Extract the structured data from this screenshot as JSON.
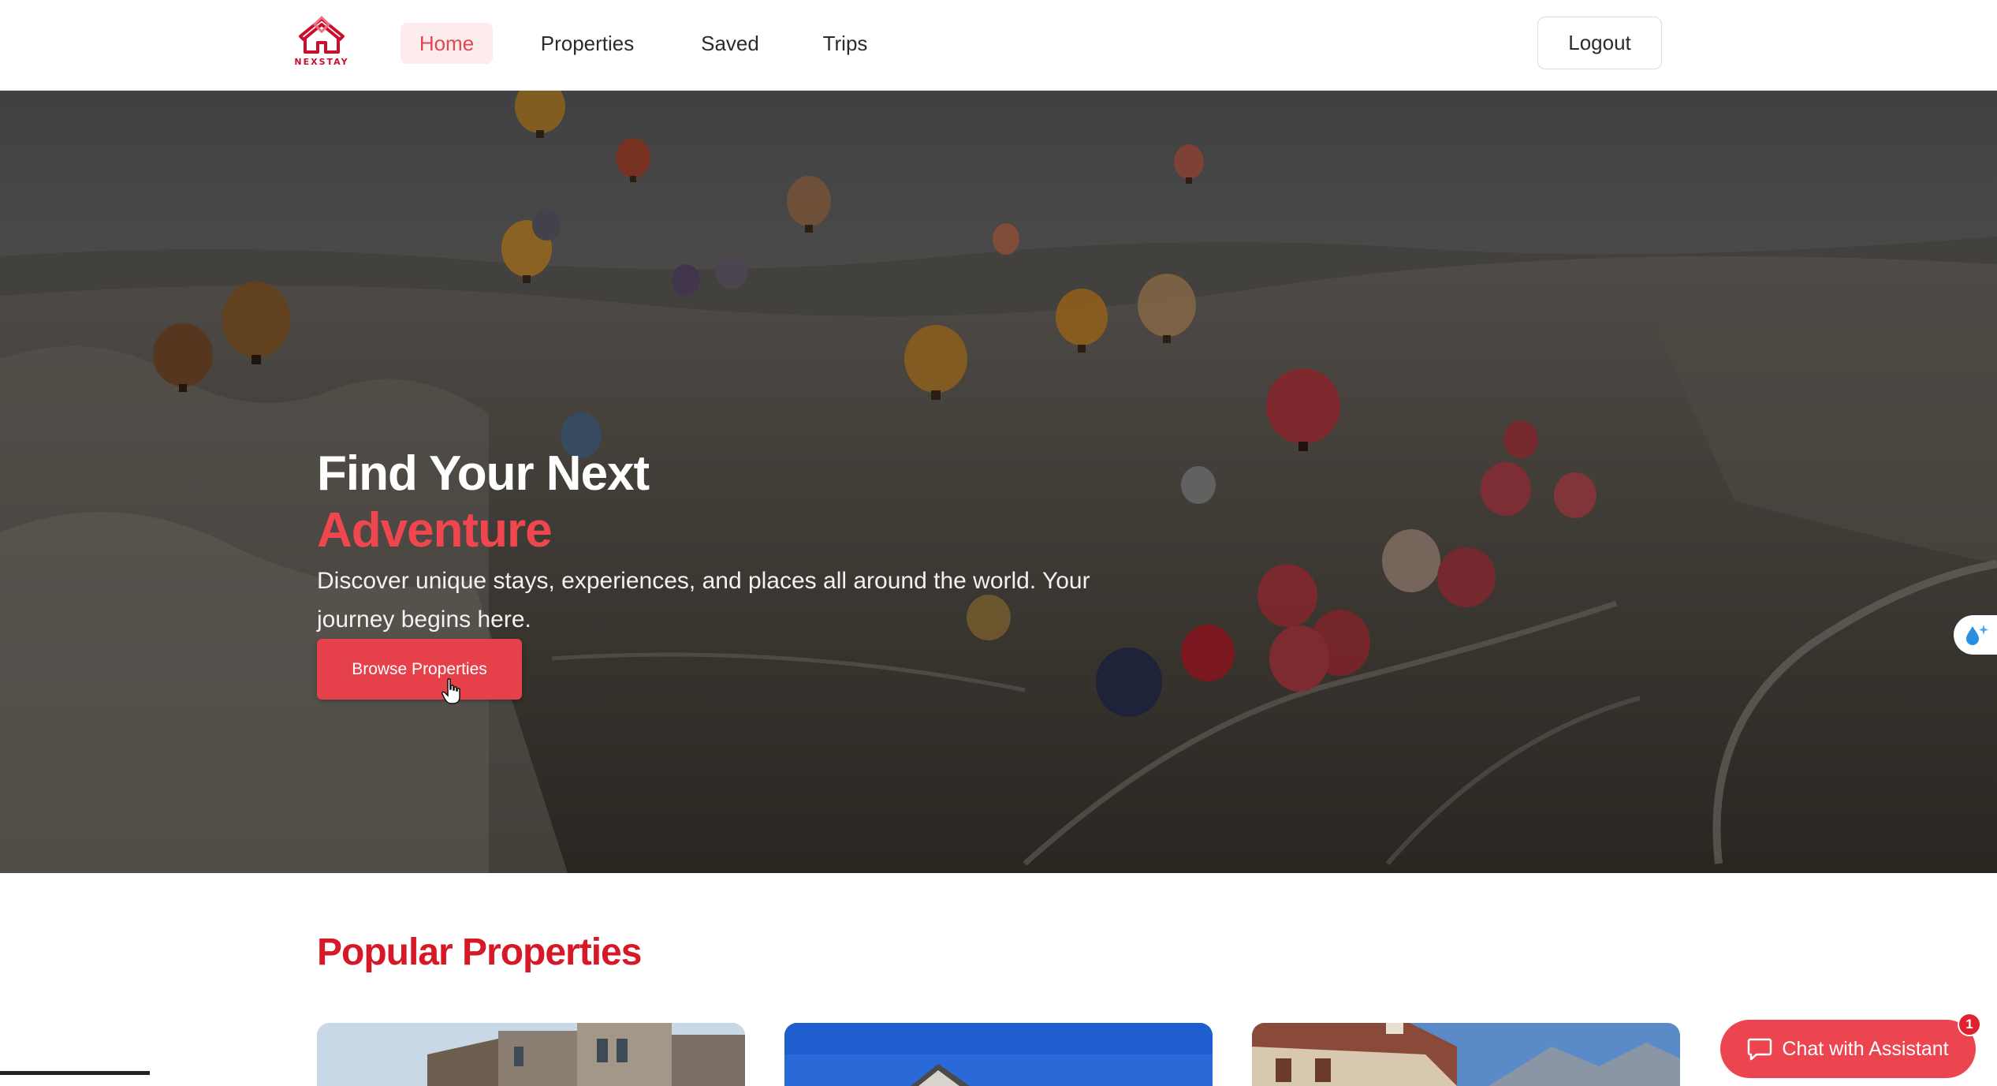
{
  "brand": {
    "name": "NEXSTAY",
    "color": "#c8102e"
  },
  "nav": {
    "items": [
      {
        "label": "Home",
        "active": true
      },
      {
        "label": "Properties",
        "active": false
      },
      {
        "label": "Saved",
        "active": false
      },
      {
        "label": "Trips",
        "active": false
      }
    ],
    "logout_label": "Logout"
  },
  "hero": {
    "title_line1": "Find Your Next",
    "title_line2": "Adventure",
    "subtitle": "Discover unique stays, experiences, and places all around the world. Your journey begins here.",
    "cta_label": "Browse Properties",
    "accent_color": "#f0474f"
  },
  "popular": {
    "title": "Popular Properties",
    "cards": [
      {
        "image": "apartment-building-photo"
      },
      {
        "image": "house-blue-sky-photo"
      },
      {
        "image": "resort-mountain-photo"
      }
    ]
  },
  "chat": {
    "label": "Chat with Assistant",
    "badge": "1",
    "color": "#ec4550"
  },
  "icons": {
    "logo": "house-logo-icon",
    "cursor": "hand-pointer-icon",
    "side_widget": "sparkle-drop-icon",
    "chat": "chat-bubble-icon"
  }
}
